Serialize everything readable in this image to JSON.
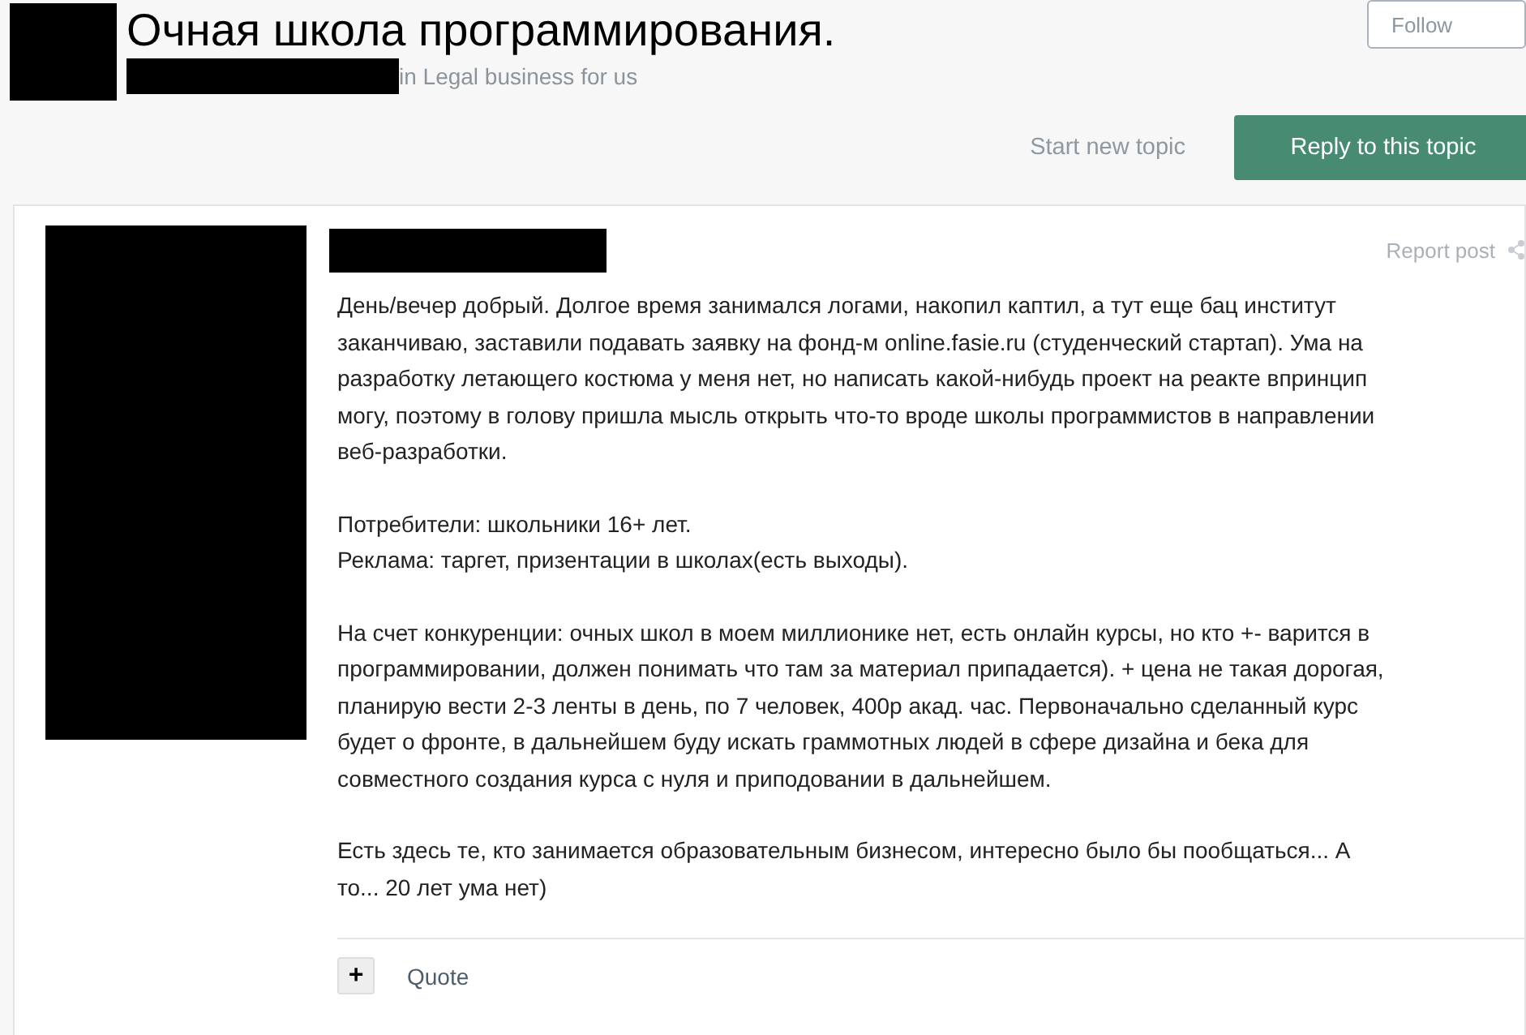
{
  "topic": {
    "title": "Очная школа программирования.",
    "forum": "in Legal business for us",
    "follow_button": "Follow"
  },
  "actions": {
    "start_new_topic": "Start new topic",
    "reply": "Reply to this topic"
  },
  "post": {
    "report": "Report post",
    "paragraphs": [
      [
        "День/вечер добрый. Долгое время занимался логами, накопил каптил, а тут еще бац институт",
        "заканчиваю, заставили подавать заявку на фонд-м online.fasie.ru (студенческий стартап). Ума на",
        "разработку летающего костюма у меня нет, но написать какой-нибудь проект на реакте впринцип",
        "могу, поэтому в голову пришла мысль открыть что-то вроде школы программистов в направлении",
        "веб-разработки."
      ],
      [
        "Потребители: школьники 16+ лет.",
        "Реклама: таргет, призентации в школах(есть выходы)."
      ],
      [
        "На счет конкуренции: очных школ в моем миллионике нет, есть онлайн курсы, но кто +- варится в",
        "программировании, должен понимать что там за материал припадается). + цена не такая дорогая,",
        "планирую вести 2-3 ленты в день, по 7 человек, 400р акад. час. Первоначально сделанный курс",
        "будет о фронте, в дальнейшем буду искать граммотных людей в сфере дизайна и бека для",
        "совместного создания курса с нуля и приподовании в дальнейшем."
      ],
      [
        "Есть здесь те, кто занимается образовательным бизнесом, интересно было бы пообщаться... А",
        "то... 20 лет ума нет)"
      ]
    ],
    "plus_button": "+",
    "quote": "Quote"
  }
}
